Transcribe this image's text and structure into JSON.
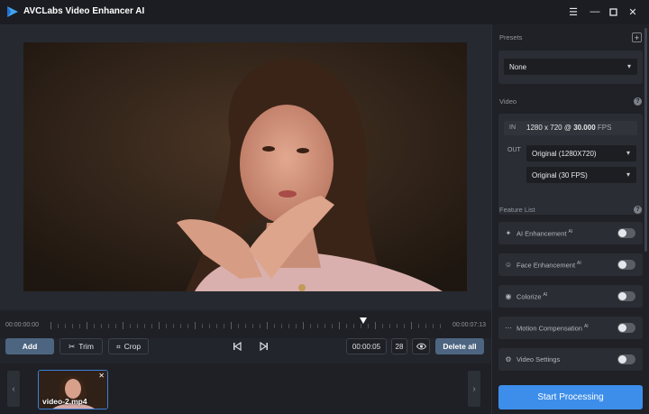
{
  "app": {
    "title": "AVCLabs Video Enhancer AI"
  },
  "window_controls": [
    "menu-icon",
    "minimize-icon",
    "maximize-icon",
    "close-icon"
  ],
  "timeline": {
    "start_time": "00:00:00:00",
    "end_time": "00:00:07:13"
  },
  "controls": {
    "add_label": "Add",
    "trim_label": "Trim",
    "crop_label": "Crop",
    "current_time": "00:00:05",
    "frame_count": "28",
    "delete_all_label": "Delete all"
  },
  "filmstrip": {
    "items": [
      {
        "name": "video-2.mp4"
      }
    ]
  },
  "presets": {
    "label": "Presets",
    "selected": "None"
  },
  "video": {
    "label": "Video",
    "in_label": "IN",
    "in_resolution": "1280 x 720",
    "in_at": "@",
    "in_fps": "30.000",
    "in_fps_unit": "FPS",
    "out_label": "OUT",
    "out_resolution": "Original (1280X720)",
    "out_fps": "Original (30 FPS)"
  },
  "feature_list": {
    "label": "Feature List",
    "items": [
      {
        "label": "AI Enhancement",
        "superscript": "AI",
        "icon": "sparkle-icon",
        "enabled": false
      },
      {
        "label": "Face Enhancement",
        "superscript": "AI",
        "icon": "face-icon",
        "enabled": false
      },
      {
        "label": "Colorize",
        "superscript": "AI",
        "icon": "palette-icon",
        "enabled": false
      },
      {
        "label": "Motion Compensation",
        "superscript": "AI",
        "icon": "motion-icon",
        "enabled": false
      },
      {
        "label": "Video Settings",
        "superscript": "",
        "icon": "gear-icon",
        "enabled": false
      }
    ]
  },
  "start_button": {
    "label": "Start Processing"
  },
  "colors": {
    "accent": "#3d8eea",
    "add_button": "#4d6580",
    "selected_border": "#3d7fd9"
  }
}
